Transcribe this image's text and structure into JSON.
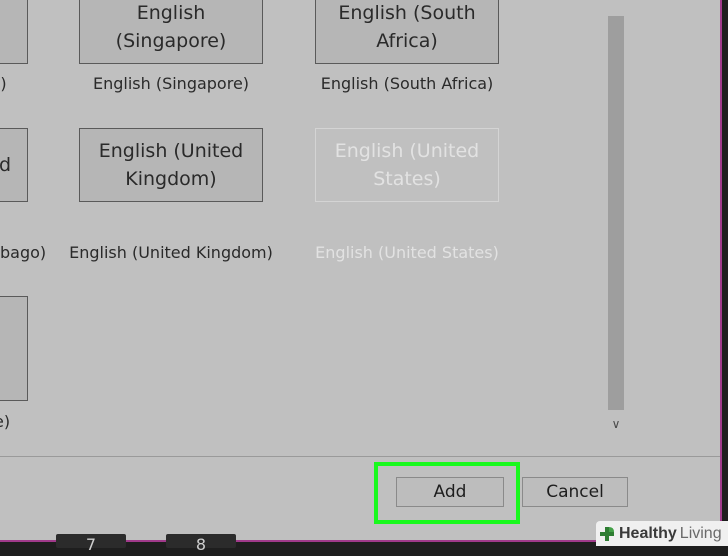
{
  "tiles": [
    {
      "label": "English\n(Singapore)",
      "caption": "English (Singapore)",
      "state": "normal"
    },
    {
      "label": "English (South\nAfrica)",
      "caption": "English (South Africa)",
      "state": "normal"
    },
    {
      "label": "English (United\nKingdom)",
      "caption": "English (United Kingdom)",
      "state": "normal"
    },
    {
      "label": "English (United\nStates)",
      "caption": "English (United States)",
      "state": "disabled"
    }
  ],
  "partial_left": {
    "row1_caption": "s)",
    "row2_tile": "d",
    "row2_caption": "bago)",
    "row3_caption": "e)"
  },
  "buttons": {
    "add": "Add",
    "cancel": "Cancel"
  },
  "scroll_arrow": "∨",
  "keys": [
    "7",
    "8"
  ],
  "watermark": {
    "part1": "Healthy",
    "part2": "Living"
  },
  "colors": {
    "highlight": "#19f91d",
    "border_accent": "#a03a8a"
  }
}
